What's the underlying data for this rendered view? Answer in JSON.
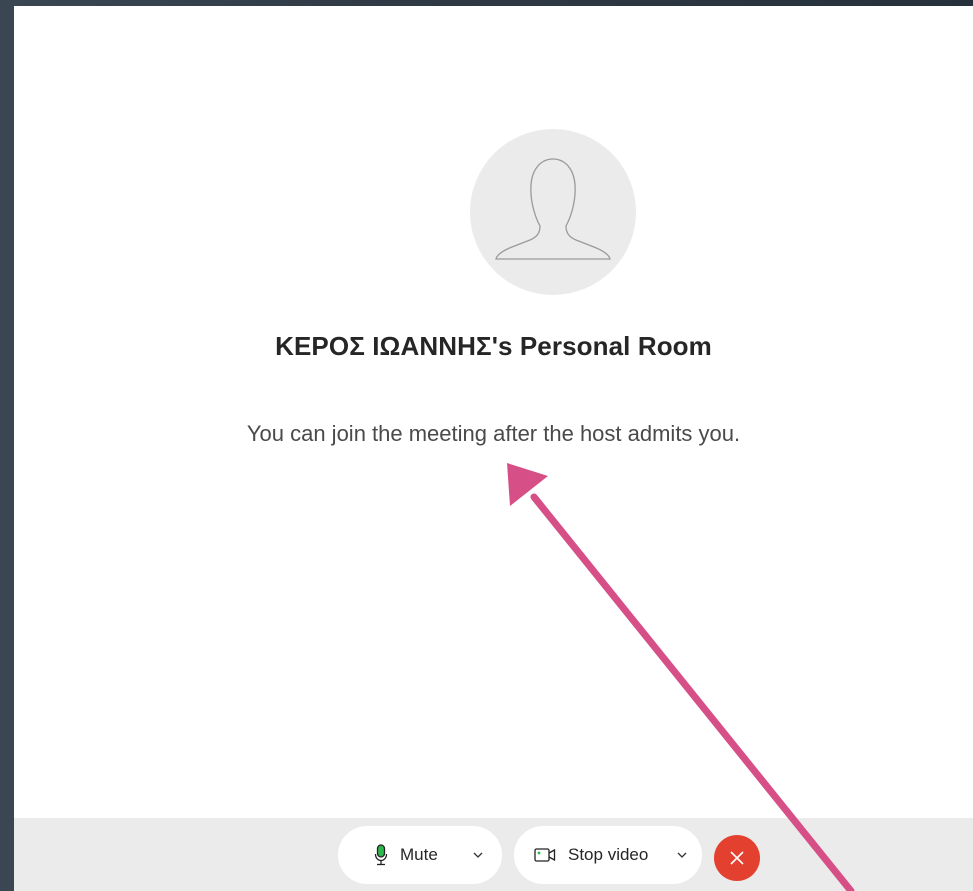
{
  "room": {
    "title": "ΚΕΡΟΣ ΙΩΑΝΝΗΣ's Personal Room",
    "status": "You can join the meeting after the host admits you."
  },
  "controls": {
    "mute_label": "Mute",
    "stop_video_label": "Stop video"
  },
  "icons": {
    "avatar": "person-silhouette",
    "mute": "microphone-icon",
    "video": "video-camera-icon",
    "dropdown": "chevron-down-icon",
    "leave": "close-icon"
  },
  "colors": {
    "leave_button": "#e3402f",
    "mic_active": "#2db84d",
    "annotation_arrow": "#d64f86",
    "control_bar": "#ebebeb"
  }
}
